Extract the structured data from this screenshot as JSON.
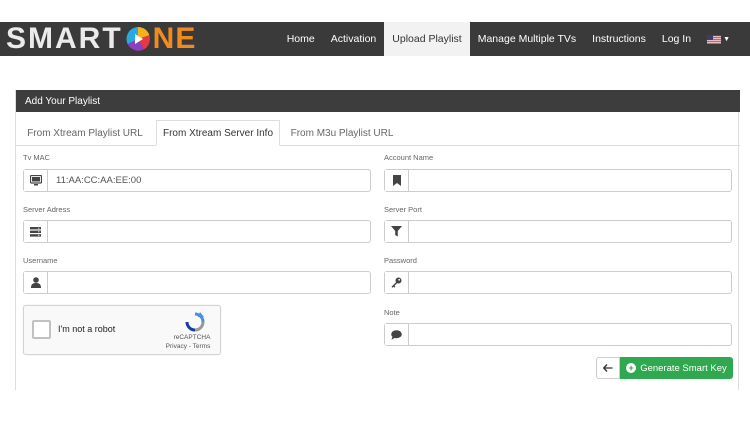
{
  "header": {
    "logo_part1": "SMART",
    "logo_part2": "NE",
    "nav": [
      {
        "label": "Home"
      },
      {
        "label": "Activation"
      },
      {
        "label": "Upload Playlist",
        "active": true
      },
      {
        "label": "Manage Multiple TVs"
      },
      {
        "label": "Instructions"
      },
      {
        "label": "Log In"
      }
    ],
    "language_flag": "us-flag-icon"
  },
  "panel": {
    "title": "Add Your Playlist",
    "tabs": [
      {
        "label": "From Xtream Playlist URL"
      },
      {
        "label": "From Xtream Server Info",
        "active": true
      },
      {
        "label": "From M3u Playlist URL"
      }
    ]
  },
  "form": {
    "tv_mac": {
      "label": "Tv MAC",
      "value": "11:AA:CC:AA:EE:00",
      "icon": "monitor-icon"
    },
    "account_name": {
      "label": "Account Name",
      "value": "",
      "icon": "bookmark-icon"
    },
    "server_address": {
      "label": "Server Adress",
      "value": "",
      "icon": "server-icon"
    },
    "server_port": {
      "label": "Server Port",
      "value": "",
      "icon": "filter-icon"
    },
    "username": {
      "label": "Username",
      "value": "",
      "icon": "user-icon"
    },
    "password": {
      "label": "Password",
      "value": "",
      "icon": "key-icon"
    },
    "note": {
      "label": "Note",
      "value": "",
      "icon": "comment-icon"
    }
  },
  "recaptcha": {
    "text": "I'm not a robot",
    "brand": "reCAPTCHA",
    "links": "Privacy - Terms"
  },
  "buttons": {
    "generate_label": "Generate Smart Key"
  },
  "colors": {
    "header_bg": "#3a3a3a",
    "logo_orange": "#f28b1e",
    "generate_green": "#2fa84f"
  }
}
